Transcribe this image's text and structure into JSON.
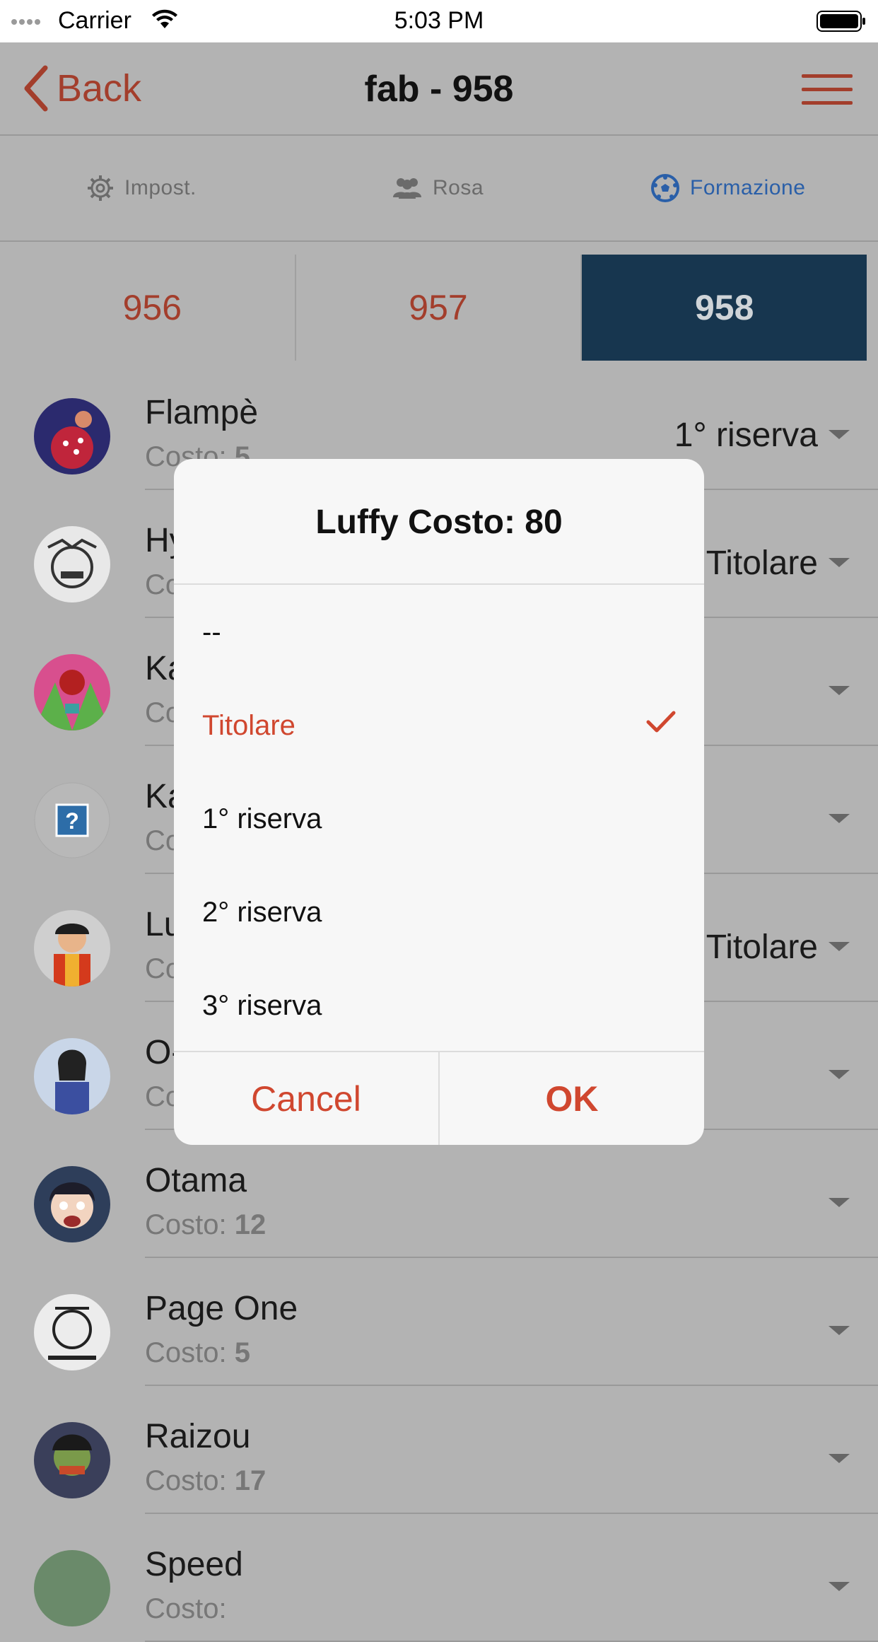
{
  "status_bar": {
    "carrier": "Carrier",
    "time": "5:03 PM"
  },
  "navbar": {
    "back_label": "Back",
    "title": "fab - 958"
  },
  "tabs": [
    {
      "label": "Impost.",
      "icon": "gear-icon"
    },
    {
      "label": "Rosa",
      "icon": "people-icon"
    },
    {
      "label": "Formazione",
      "icon": "soccer-ball-icon",
      "active": true
    }
  ],
  "segments": [
    "956",
    "957",
    "958"
  ],
  "segment_selected": "958",
  "players": [
    {
      "name": "Flampè",
      "cost_label": "Costo:",
      "cost": "5",
      "role": "1° riserva"
    },
    {
      "name": "Hyogoro",
      "cost_label": "Costo:",
      "cost": "",
      "role": "Titolare"
    },
    {
      "name": "Kanjuro",
      "cost_label": "Costo:",
      "cost": "",
      "role": ""
    },
    {
      "name": "Kawamatsu",
      "cost_label": "Costo:",
      "cost": "",
      "role": ""
    },
    {
      "name": "Luffy",
      "cost_label": "Costo:",
      "cost": "80",
      "role": "Titolare"
    },
    {
      "name": "O-Kiku",
      "cost_label": "Costo:",
      "cost": "",
      "role": ""
    },
    {
      "name": "Otama",
      "cost_label": "Costo:",
      "cost": "12",
      "role": ""
    },
    {
      "name": "Page One",
      "cost_label": "Costo:",
      "cost": "5",
      "role": ""
    },
    {
      "name": "Raizou",
      "cost_label": "Costo:",
      "cost": "17",
      "role": ""
    },
    {
      "name": "Speed",
      "cost_label": "Costo:",
      "cost": "",
      "role": ""
    }
  ],
  "dialog": {
    "title": "Luffy Costo: 80",
    "options": [
      "--",
      "Titolare",
      "1° riserva",
      "2° riserva",
      "3° riserva"
    ],
    "selected": "Titolare",
    "cancel_label": "Cancel",
    "ok_label": "OK"
  },
  "colors": {
    "accent": "#d0472f",
    "nav_accent": "#a33e2c",
    "active_tab": "#2a5fa8",
    "segment_active_bg": "#17364f"
  }
}
